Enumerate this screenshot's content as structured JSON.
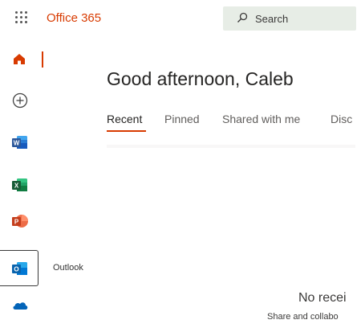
{
  "header": {
    "brand": "Office 365",
    "search_label": "Search"
  },
  "rail": {
    "items": [
      {
        "name": "home",
        "color": "#d83b01"
      },
      {
        "name": "create",
        "color": "#444444"
      },
      {
        "name": "word",
        "color": "#2b579a"
      },
      {
        "name": "excel",
        "color": "#217346"
      },
      {
        "name": "powerpoint",
        "color": "#d24726"
      },
      {
        "name": "outlook",
        "color": "#0078d4"
      },
      {
        "name": "onedrive",
        "color": "#0364b8"
      }
    ],
    "tooltip": "Outlook"
  },
  "main": {
    "greeting": "Good afternoon, Caleb",
    "tabs": [
      {
        "label": "Recent",
        "active": true
      },
      {
        "label": "Pinned",
        "active": false
      },
      {
        "label": "Shared with me",
        "active": false
      },
      {
        "label": "Disc",
        "active": false
      }
    ],
    "empty_title": "No recei",
    "empty_subtitle": "Share and collabo"
  },
  "colors": {
    "accent": "#d83b01",
    "search_bg": "#e7ede6"
  }
}
